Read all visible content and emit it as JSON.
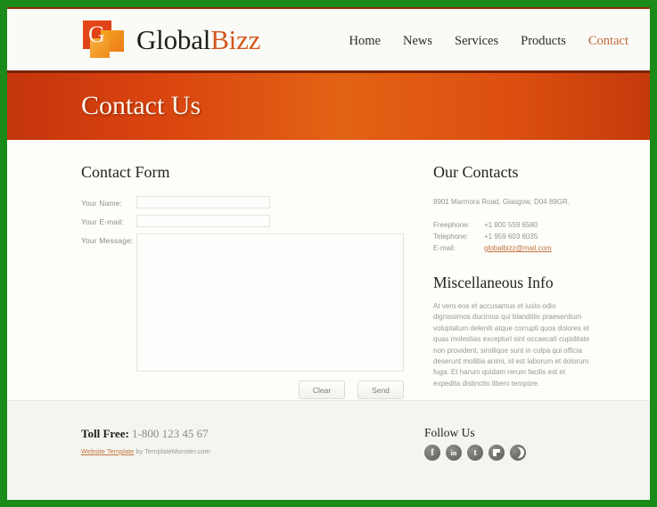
{
  "site": {
    "logo": {
      "letter": "G",
      "name_part1": "Global",
      "name_part2": "Bizz"
    },
    "nav": [
      {
        "label": "Home",
        "active": false
      },
      {
        "label": "News",
        "active": false
      },
      {
        "label": "Services",
        "active": false
      },
      {
        "label": "Products",
        "active": false
      },
      {
        "label": "Contact",
        "active": true
      }
    ]
  },
  "banner": {
    "title": "Contact Us"
  },
  "contact_form": {
    "heading": "Contact Form",
    "fields": [
      {
        "label": "Your Name:",
        "value": "",
        "placeholder": ""
      },
      {
        "label": "Your E-mail:",
        "value": "",
        "placeholder": ""
      },
      {
        "label": "Your Message:",
        "value": "",
        "placeholder": ""
      }
    ],
    "buttons": {
      "clear": "Clear",
      "send": "Send"
    }
  },
  "our_contacts": {
    "heading": "Our Contacts",
    "address": "8901 Marmora Road, Glasgow, D04 89GR.",
    "rows": [
      {
        "key": "Freephone:",
        "value": "+1 800 559 6580",
        "is_link": false
      },
      {
        "key": "Telephone:",
        "value": "+1 959 603 6035",
        "is_link": false
      },
      {
        "key": "E-mail:",
        "value": "globalbizz@mail.com",
        "is_link": true
      }
    ]
  },
  "misc_info": {
    "heading": "Miscellaneous Info",
    "paragraph": "At vero eos et accusamus et iusto odio dignissimos ducimus qui blanditiis praesentium voluptatum deleniti atque corrupti quos dolores et quas molestias excepturi sint occaecati cupiditate non provident, similique sunt in culpa qui officia deserunt mollitia animi, id est laborum et dolorum fuga. Et harum quidam rerum facilis est et expedita distinctio libero tempore."
  },
  "footer": {
    "toll_free_label": "Toll Free:",
    "toll_free_number": "1-800 123 45 67",
    "credit_link": "Website Template",
    "credit_rest": " by TemplateMonster.com",
    "follow_heading": "Follow Us",
    "social": [
      {
        "name": "facebook-icon",
        "glyph": "f"
      },
      {
        "name": "linkedin-icon",
        "glyph": "in"
      },
      {
        "name": "twitter-icon",
        "glyph": "t"
      },
      {
        "name": "delicious-icon",
        "glyph": ""
      },
      {
        "name": "crescent-icon",
        "glyph": ""
      }
    ]
  },
  "colors": {
    "frame_green": "#1a8a18",
    "banner_orange": "#e26214",
    "accent_orange": "#d4571d",
    "link_brown": "#c4733f"
  }
}
